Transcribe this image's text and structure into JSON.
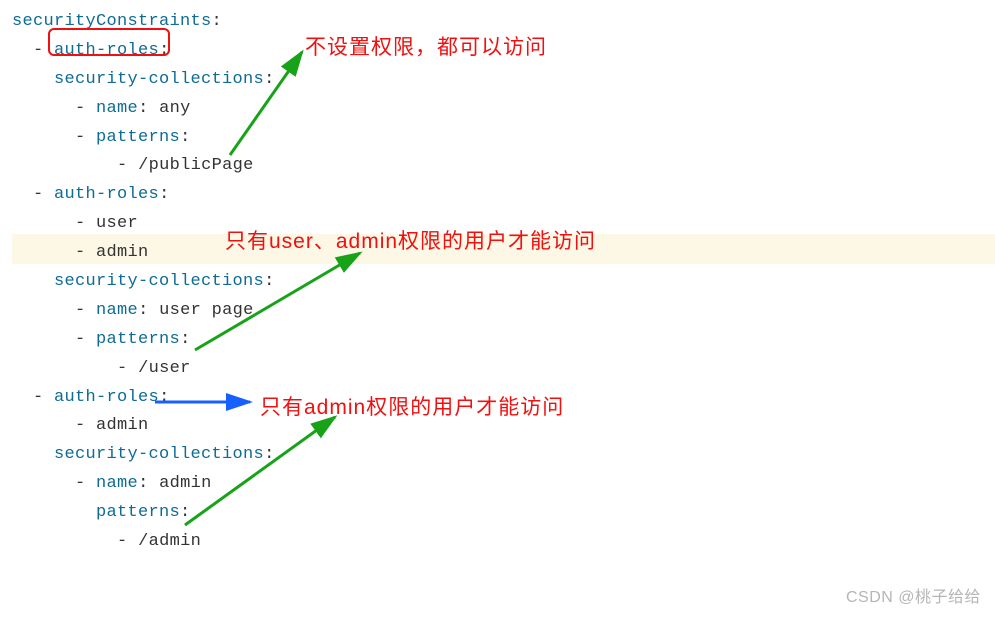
{
  "code": {
    "l1": "securityConstraints",
    "l2_key": "auth-roles",
    "l3_key": "security-collections",
    "l4_key": "name",
    "l4_val": "any",
    "l5_key": "patterns",
    "l6_val": "/publicPage",
    "l7_key": "auth-roles",
    "l8_val": "user",
    "l9_val": "admin",
    "l10_key": "security-collections",
    "l11_key": "name",
    "l11_val": "user page",
    "l12_key": "patterns",
    "l13_val": "/user",
    "l14_key": "auth-roles",
    "l15_val": "admin",
    "l16_key": "security-collections",
    "l17_key": "name",
    "l17_val": "admin",
    "l18_key": "patterns",
    "l19_val": "/admin"
  },
  "annotations": {
    "a1": "不设置权限，都可以访问",
    "a2": "只有user、admin权限的用户才能访问",
    "a3": "只有admin权限的用户才能访问"
  },
  "watermark": "CSDN @桃子给给"
}
